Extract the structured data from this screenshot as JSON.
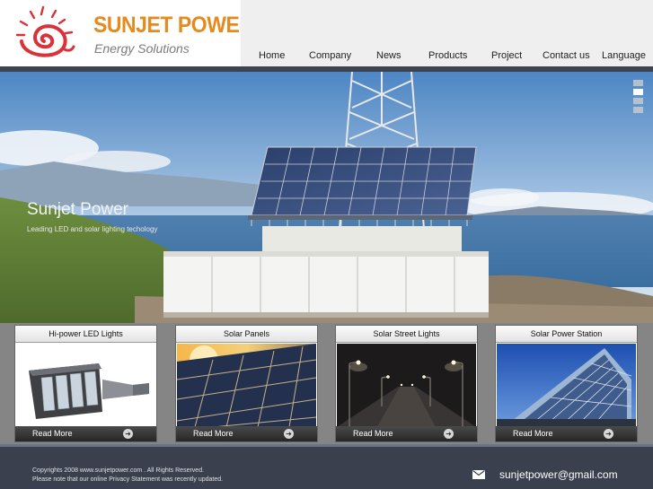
{
  "brand": {
    "name": "SUNJET POWER",
    "tagline": "Energy Solutions"
  },
  "nav": [
    {
      "label": "Home"
    },
    {
      "label": "Company"
    },
    {
      "label": "News"
    },
    {
      "label": "Products"
    },
    {
      "label": "Project"
    },
    {
      "label": "Contact us"
    },
    {
      "label": "Language"
    }
  ],
  "hero": {
    "title": "Sunjet Power",
    "subtitle": "Leading LED and solar lighting techology",
    "slides": 4,
    "active_slide": 2
  },
  "products": [
    {
      "title": "Hi-power LED Lights",
      "read_more": "Read More",
      "icon": "arrow-right-icon"
    },
    {
      "title": "Solar Panels",
      "read_more": "Read More",
      "icon": "arrow-right-icon"
    },
    {
      "title": "Solar Street Lights",
      "read_more": "Read More",
      "icon": "arrow-right-icon"
    },
    {
      "title": "Solar Power Station",
      "read_more": "Read More",
      "icon": "arrow-right-icon"
    }
  ],
  "footer": {
    "copyright": "Copyrights 2008 www.sunjetpower.com . All Rights Reserved.",
    "privacy": "Please note that our online Privacy Statement was recently updated.",
    "email": "sunjetpower@gmail.com",
    "email_icon": "envelope-icon"
  },
  "colors": {
    "brand_orange": "#e48a1e",
    "logo_red": "#d8323a",
    "nav_bg": "#efefef",
    "dark_bar": "#3d4350",
    "strip_gray": "#858585",
    "footer_bg": "#3a404d"
  }
}
